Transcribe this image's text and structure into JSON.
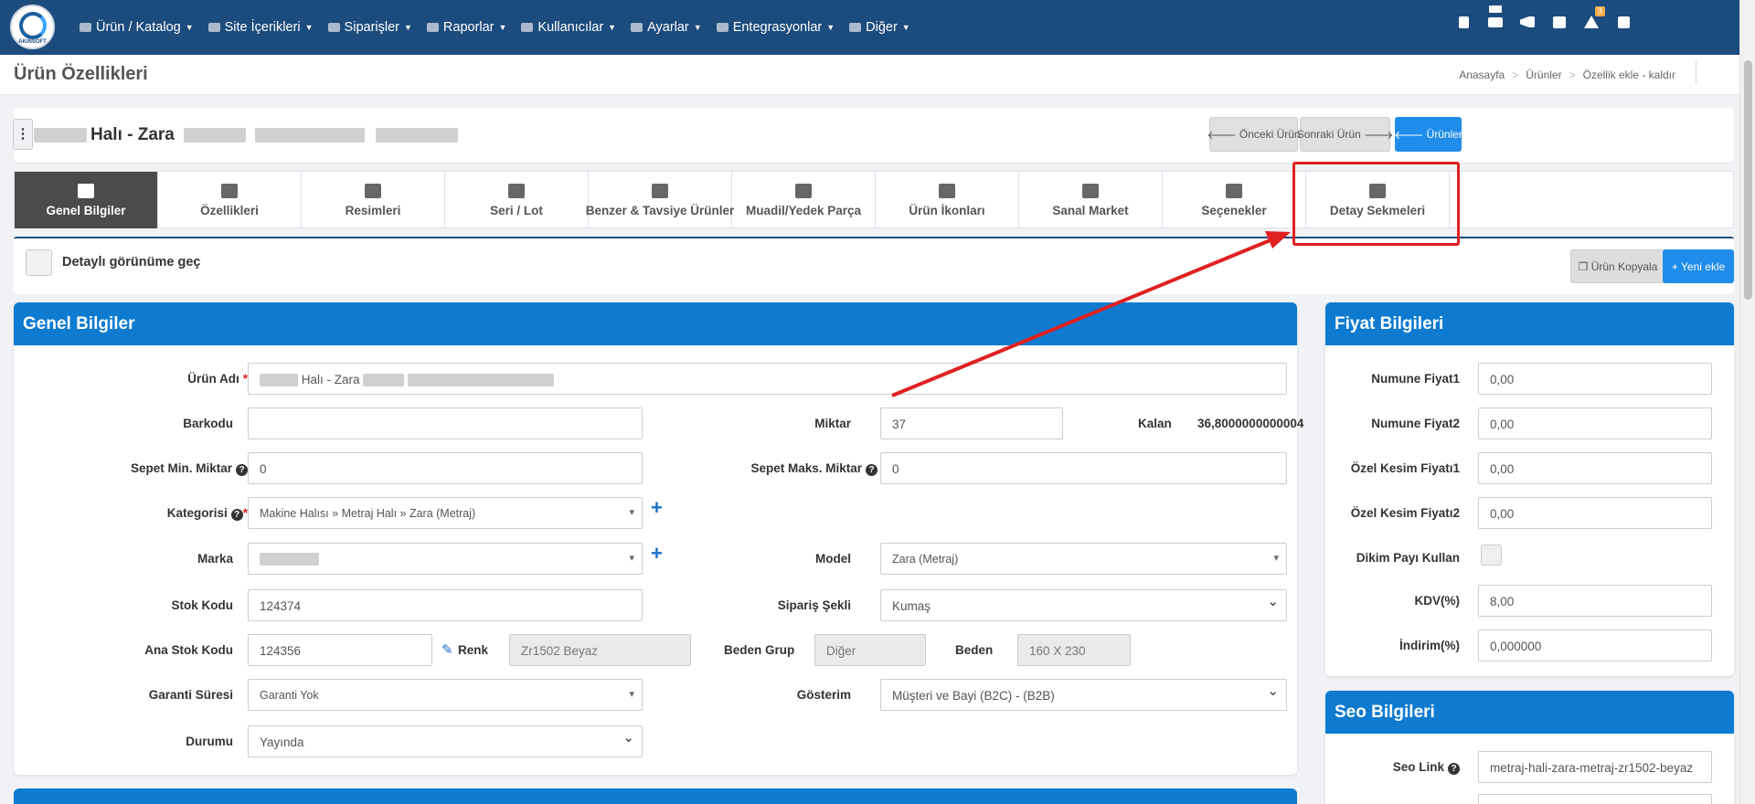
{
  "app": {
    "logo_text": "AKINSOFT"
  },
  "nav": {
    "items": [
      {
        "label": "Ürün / Katalog",
        "icon": "boxes-icon"
      },
      {
        "label": "Site İçerikleri",
        "icon": "copy-icon"
      },
      {
        "label": "Siparişler",
        "icon": "handshake-icon"
      },
      {
        "label": "Raporlar",
        "icon": "file-icon"
      },
      {
        "label": "Kullanıcılar",
        "icon": "users-icon"
      },
      {
        "label": "Ayarlar",
        "icon": "cogs-icon"
      },
      {
        "label": "Entegrasyonlar",
        "icon": "sitemap-icon"
      },
      {
        "label": "Diğer",
        "icon": "cube-icon"
      }
    ],
    "alert_count": "3"
  },
  "page": {
    "title": "Ürün Özellikleri",
    "breadcrumb": [
      "Anasayfa",
      "Ürünler",
      "Özellik ekle - kaldır"
    ]
  },
  "product": {
    "name": "Halı - Zara",
    "prev_label": "Önceki Ürün",
    "next_label": "Sonraki Ürün",
    "list_label": "Ürünler"
  },
  "tabs": [
    {
      "label": "Genel Bilgiler",
      "icon": "cogs-icon"
    },
    {
      "label": "Özellikleri",
      "icon": "copy-icon"
    },
    {
      "label": "Resimleri",
      "icon": "images-icon"
    },
    {
      "label": "Seri / Lot",
      "icon": "barcode-icon"
    },
    {
      "label": "Benzer & Tavsiye Ürünler",
      "icon": "balance-scale-icon"
    },
    {
      "label": "Muadil/Yedek Parça",
      "icon": "check-square-icon"
    },
    {
      "label": "Ürün İkonları",
      "icon": "file-image-icon"
    },
    {
      "label": "Sanal Market",
      "icon": "cart-icon"
    },
    {
      "label": "Seçenekler",
      "icon": "list-icon"
    },
    {
      "label": "Detay Sekmeleri",
      "icon": "sitemap-icon"
    }
  ],
  "detail": {
    "toggle_label": "Detaylı görünüme geç",
    "copy_label": "Ürün Kopyala",
    "new_label": "Yeni ekle"
  },
  "general": {
    "title": "Genel Bilgiler",
    "urun_adi_label": "Ürün Adı",
    "urun_adi_value": "Halı - Zara",
    "barkod_label": "Barkodu",
    "barkod_value": "",
    "miktar_label": "Miktar",
    "miktar_value": "37",
    "kalan_label": "Kalan",
    "kalan_value": "36,8000000000004",
    "sepet_min_label": "Sepet Min. Miktar",
    "sepet_min_value": "0",
    "sepet_maks_label": "Sepet Maks. Miktar",
    "sepet_maks_value": "0",
    "kategori_label": "Kategorisi",
    "kategori_value": "Makine Halısı » Metraj Halı » Zara (Metraj)",
    "marka_label": "Marka",
    "marka_value": "",
    "model_label": "Model",
    "model_value": "Zara (Metraj)",
    "stok_kodu_label": "Stok Kodu",
    "stok_kodu_value": "124374",
    "siparis_label": "Sipariş Şekli",
    "siparis_value": "Kumaş",
    "ana_stok_label": "Ana Stok Kodu",
    "ana_stok_value": "124356",
    "renk_label": "Renk",
    "renk_value": "Zr1502 Beyaz",
    "beden_grup_label": "Beden Grup",
    "beden_grup_value": "Diğer",
    "beden_label": "Beden",
    "beden_value": "160 X 230",
    "garanti_label": "Garanti Süresi",
    "garanti_value": "Garanti Yok",
    "gosterim_label": "Gösterim",
    "gosterim_value": "Müşteri ve Bayi (B2C) - (B2B)",
    "durum_label": "Durumu",
    "durum_value": "Yayında"
  },
  "price": {
    "title": "Fiyat Bilgileri",
    "rows": [
      {
        "label": "Numune Fiyat1",
        "value": "0,00"
      },
      {
        "label": "Numune Fiyat2",
        "value": "0,00"
      },
      {
        "label": "Özel Kesim Fiyatı1",
        "value": "0,00"
      },
      {
        "label": "Özel Kesim Fiyatı2",
        "value": "0,00"
      }
    ],
    "dikim_label": "Dikim Payı Kullan",
    "kdv_label": "KDV(%)",
    "kdv_value": "8,00",
    "indirim_label": "İndirim(%)",
    "indirim_value": "0,000000"
  },
  "seo": {
    "title": "Seo Bilgileri",
    "link_label": "Seo Link",
    "link_value": "metraj-hali-zara-metraj-zr1502-beyaz"
  }
}
